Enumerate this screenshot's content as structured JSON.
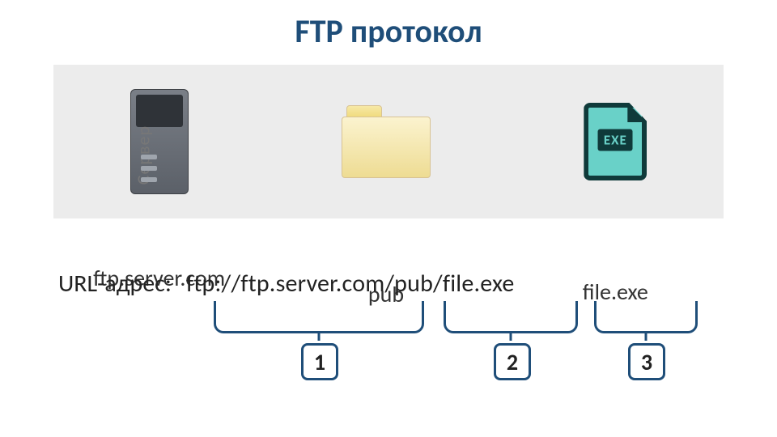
{
  "title": "FTP протокол",
  "panel": {
    "server": {
      "rotated_label": "Сервер",
      "caption": "ftp.server.com"
    },
    "folder": {
      "caption": "pub"
    },
    "file": {
      "badge": "EXE",
      "caption": "file.exe"
    }
  },
  "url": {
    "label": "URL-адрес:",
    "value": "ftp://ftp.server.com/pub/file.exe"
  },
  "segments": {
    "n1": "1",
    "n2": "2",
    "n3": "3"
  }
}
